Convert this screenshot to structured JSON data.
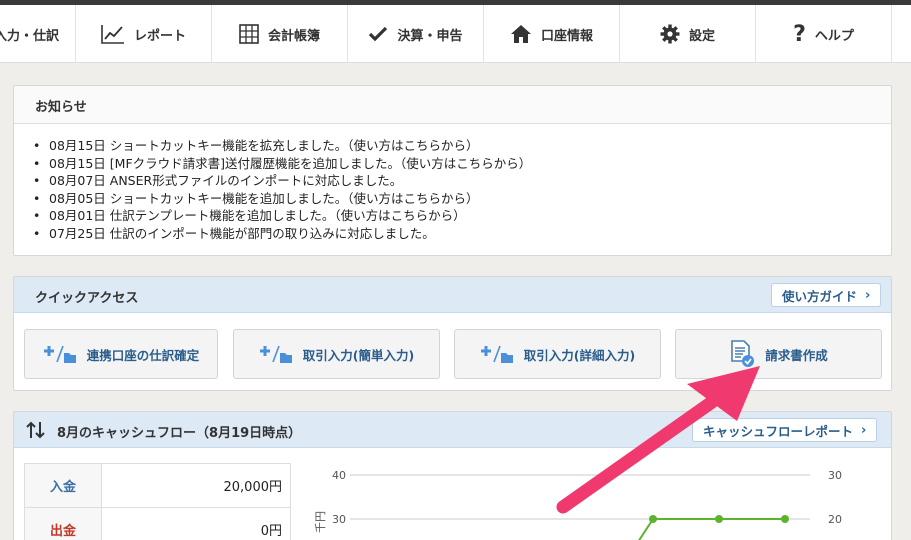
{
  "nav": {
    "items": [
      {
        "label": "入力・仕訳",
        "icon": "none"
      },
      {
        "label": "レポート",
        "icon": "chart-line-icon"
      },
      {
        "label": "会計帳簿",
        "icon": "grid-icon"
      },
      {
        "label": "決算・申告",
        "icon": "check-icon"
      },
      {
        "label": "口座情報",
        "icon": "home-icon"
      },
      {
        "label": "設定",
        "icon": "gear-icon"
      },
      {
        "label": "ヘルプ",
        "icon": "question-icon"
      }
    ]
  },
  "notice": {
    "title": "お知らせ",
    "items": [
      "08月15日 ショートカットキー機能を拡充しました。（使い方はこちらから）",
      "08月15日 [MFクラウド請求書]送付履歴機能を追加しました。（使い方はこちらから）",
      "08月07日 ANSER形式ファイルのインポートに対応しました。",
      "08月05日 ショートカットキー機能を追加しました。（使い方はこちらから）",
      "08月01日 仕訳テンプレート機能を追加しました。（使い方はこちらから）",
      "07月25日 仕訳のインポート機能が部門の取り込みに対応しました。"
    ]
  },
  "quick": {
    "title": "クイックアクセス",
    "guide": "使い方ガイド",
    "buttons": [
      {
        "label": "連携口座の仕訳確定",
        "icon": "plus-folder-icon"
      },
      {
        "label": "取引入力(簡単入力)",
        "icon": "plus-folder-icon"
      },
      {
        "label": "取引入力(詳細入力)",
        "icon": "plus-folder-icon"
      },
      {
        "label": "請求書作成",
        "icon": "invoice-icon"
      }
    ]
  },
  "cashflow": {
    "title": "8月のキャッシュフロー（8月19日時点）",
    "report_link": "キャッシュフローレポート",
    "rows": [
      {
        "label": "入金",
        "value": "20,000円"
      },
      {
        "label": "出金",
        "value": "0円"
      }
    ]
  },
  "chart_data": {
    "type": "line",
    "left_axis_ticks": [
      "40",
      "30"
    ],
    "right_axis_ticks": [
      "30",
      "20"
    ],
    "ylabel": "千円",
    "series": [
      {
        "values": [
          30,
          30,
          30
        ]
      }
    ],
    "color": "#5db22e"
  },
  "annotation": {
    "color": "#f0396e"
  }
}
